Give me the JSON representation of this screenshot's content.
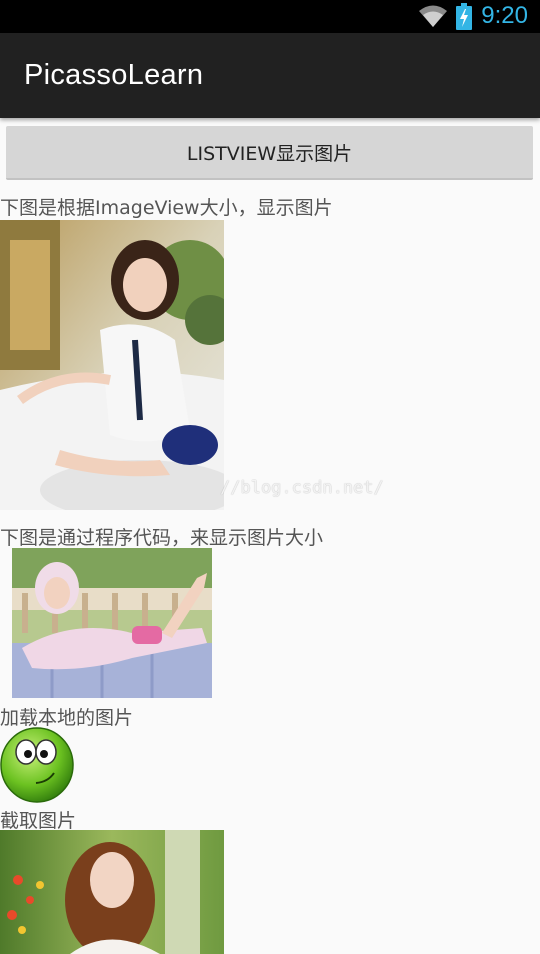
{
  "status_bar": {
    "time": "9:20",
    "icons": [
      "wifi-icon",
      "battery-icon"
    ],
    "accent": "#33b5e5"
  },
  "app_bar": {
    "title": "PicassoLearn"
  },
  "button": {
    "label": "LISTVIEW显示图片"
  },
  "sections": [
    {
      "label": "下图是根据ImageView大小，显示图片",
      "image": "photo-girl-kneeling-white-shirt"
    },
    {
      "label": "下图是通过程序代码，来显示图片大小",
      "image": "photo-girl-lying-pink-hoodie"
    },
    {
      "label": "加载本地的图片",
      "image": "green-smiley-icon"
    },
    {
      "label": "截取图片",
      "image": "photo-girl-flowers-cropped"
    }
  ],
  "watermark": "//blog.csdn.net/"
}
